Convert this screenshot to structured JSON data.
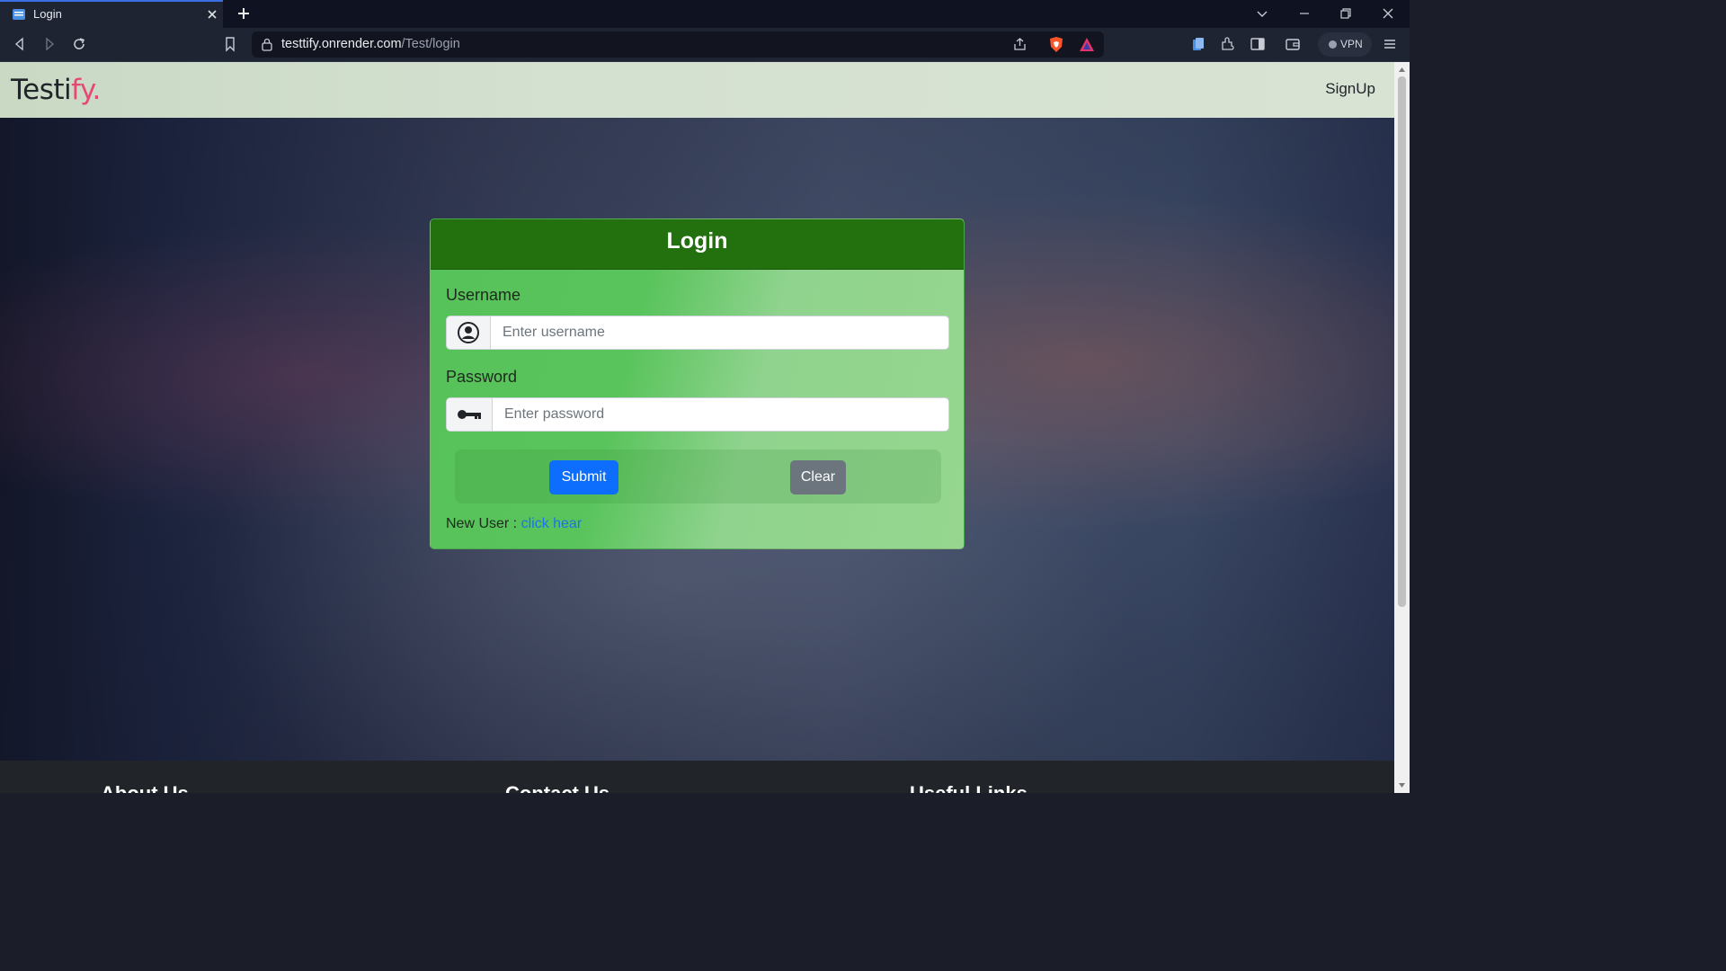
{
  "browser": {
    "tab_title": "Login",
    "url_host": "testtify.onrender.com",
    "url_path": "/Test/login",
    "vpn_label": "VPN"
  },
  "navbar": {
    "brand_main": "Testi",
    "brand_accent": "fy.",
    "signup_label": "SignUp"
  },
  "login": {
    "title": "Login",
    "username_label": "Username",
    "username_placeholder": "Enter username",
    "password_label": "Password",
    "password_placeholder": "Enter password",
    "submit_label": "Submit",
    "clear_label": "Clear",
    "new_user_text": "New User : ",
    "new_user_link": "click hear"
  },
  "footer": {
    "headings": [
      "About Us",
      "Contact Us",
      "Useful Links"
    ]
  },
  "colors": {
    "card_header": "#23710e",
    "submit": "#0d6efd",
    "clear": "#6c757d",
    "brand_accent": "#e64876"
  }
}
